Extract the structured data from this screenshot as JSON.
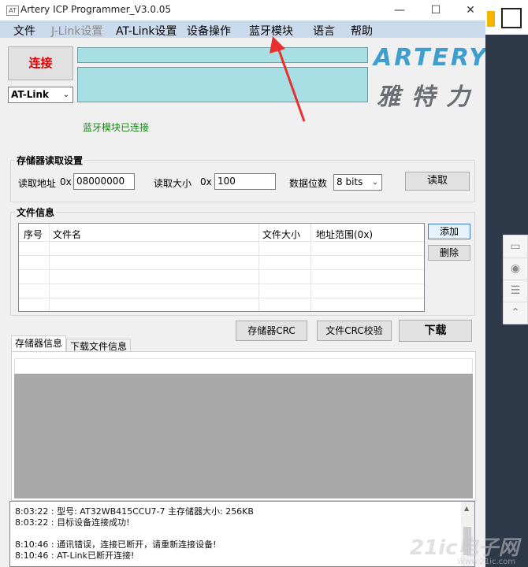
{
  "window": {
    "title": "Artery ICP Programmer_V3.0.05",
    "app_icon": "AT",
    "minimize": "—",
    "maximize": "☐",
    "close": "✕"
  },
  "menu": [
    {
      "label": "文件",
      "enabled": true
    },
    {
      "label": "J-Link设置",
      "enabled": false
    },
    {
      "label": "AT-Link设置",
      "enabled": true
    },
    {
      "label": "设备操作",
      "enabled": true
    },
    {
      "label": "蓝牙模块",
      "enabled": true
    },
    {
      "label": "语言",
      "enabled": true
    },
    {
      "label": "帮助",
      "enabled": true
    }
  ],
  "connection": {
    "connect_label": "连接",
    "link_type": "AT-Link",
    "bt_status": "蓝牙模块已连接"
  },
  "logo": {
    "brand": "ARTERY",
    "brand_cn": "雅特力"
  },
  "read_settings": {
    "title": "存储器读取设置",
    "addr_label": "读取地址",
    "addr_prefix": "0x",
    "addr_value": "08000000",
    "size_label": "读取大小",
    "size_prefix": "0x",
    "size_value": "100",
    "bits_label": "数据位数",
    "bits_value": "8 bits",
    "read_button": "读取"
  },
  "file_info": {
    "title": "文件信息",
    "columns": [
      "序号",
      "文件名",
      "文件大小",
      "地址范围(0x)"
    ],
    "add_button": "添加",
    "delete_button": "删除"
  },
  "actions": {
    "crc_button": "存储器CRC",
    "file_crc_button": "文件CRC校验",
    "download_button": "下载"
  },
  "tabs": {
    "memory_info": "存储器信息",
    "download_file_info": "下载文件信息"
  },
  "log": [
    "8:03:22 : 型号:   AT32WB415CCU7-7          主存储器大小: 256KB",
    "8:03:22 : 目标设备连接成功!",
    "",
    "8:10:46 : 通讯错误，连接已断开，请重新连接设备!",
    "8:10:46 : AT-Link已断开连接!"
  ],
  "watermark": {
    "text": "21ic电子网",
    "sub": "Www.21ic.com"
  },
  "colors": {
    "accent_blue": "#cad9ec",
    "status_bar_cyan": "#a8dfe4",
    "connect_red": "#e00000",
    "status_green": "#138a12",
    "annotation_arrow": "#e8312f"
  }
}
